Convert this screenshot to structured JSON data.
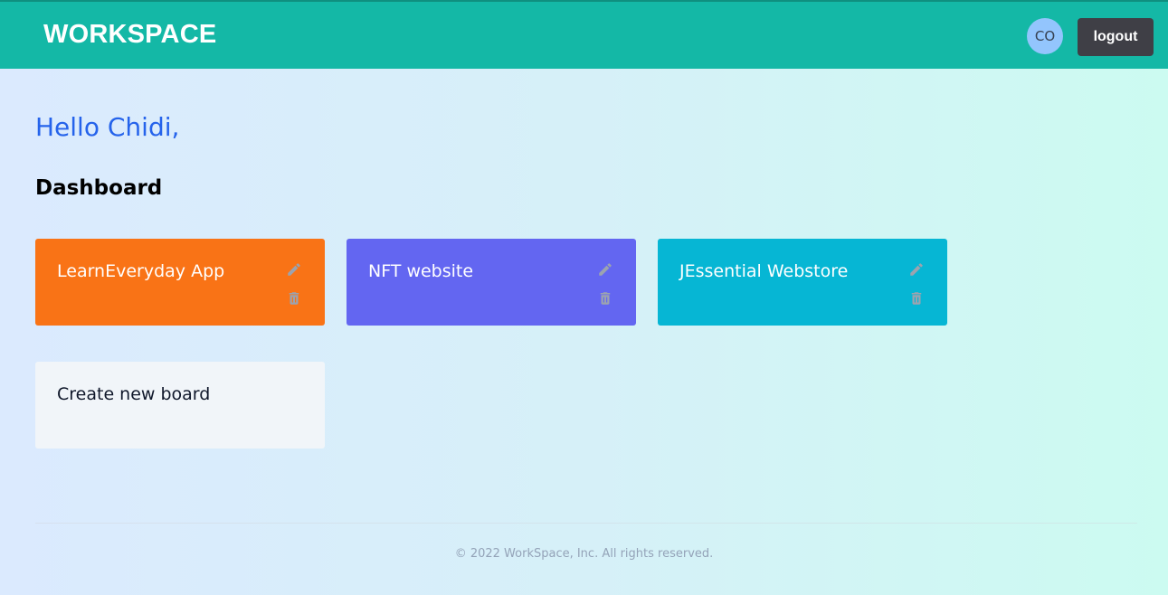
{
  "header": {
    "brand": "WORKSPACE",
    "avatar_initials": "CO",
    "logout_label": "logout"
  },
  "main": {
    "greeting": "Hello Chidi,",
    "section_title": "Dashboard",
    "boards": [
      {
        "name": "LearnEveryday App",
        "color": "#f97316",
        "edit_icon": "pencil-icon",
        "delete_icon": "trash-icon"
      },
      {
        "name": "NFT website",
        "color": "#6366f1",
        "edit_icon": "pencil-icon",
        "delete_icon": "trash-icon"
      },
      {
        "name": "JEssential Webstore",
        "color": "#06b6d4",
        "edit_icon": "pencil-icon",
        "delete_icon": "trash-icon"
      }
    ],
    "create_board_label": "Create new board"
  },
  "footer": {
    "copyright": "© 2022 WorkSpace, Inc. All rights reserved."
  },
  "colors": {
    "header_bg": "#14b8a6",
    "greeting": "#2563eb",
    "logout_bg": "#3f3f46",
    "avatar_bg": "#93c5fd",
    "icon_gray": "#9ca3af",
    "create_card_bg": "#f1f5f9"
  }
}
